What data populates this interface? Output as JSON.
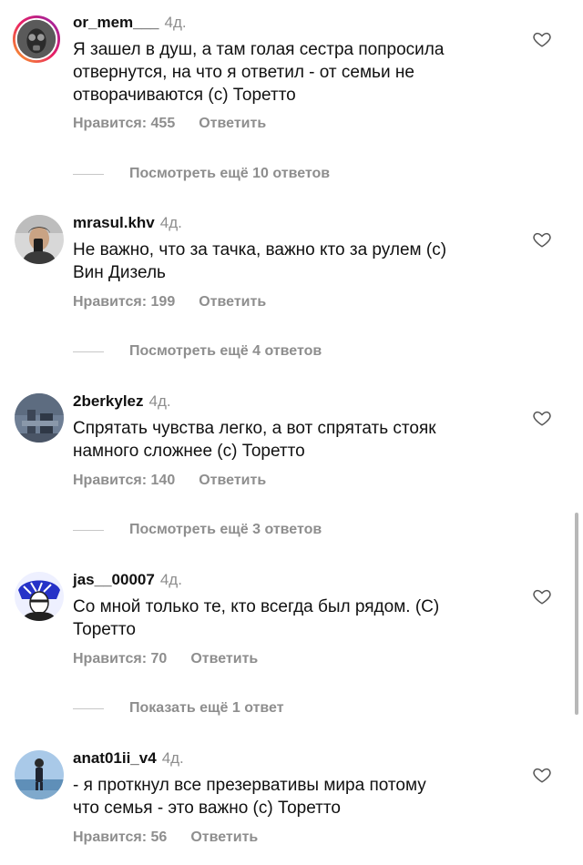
{
  "comments": [
    {
      "username": "or_mem___",
      "time": "4д.",
      "text": "Я зашел в душ, а там голая сестра попросила\nотвернутся, на что я ответил - от семьи не\nотворачиваются (с) Торетто",
      "likes": "Нравится: 455",
      "reply": "Ответить",
      "more": "Посмотреть ещё 10 ответов"
    },
    {
      "username": "mrasul.khv",
      "time": "4д.",
      "text": "Не важно, что за тачка, важно кто за рулем (с)\nВин Дизель",
      "likes": "Нравится: 199",
      "reply": "Ответить",
      "more": "Посмотреть ещё 4 ответов"
    },
    {
      "username": "2berkylez",
      "time": "4д.",
      "text": "Спрятать чувства легко, а вот спрятать стояк\nнамного сложнее (с) Торетто",
      "likes": "Нравится: 140",
      "reply": "Ответить",
      "more": "Посмотреть ещё 3 ответов"
    },
    {
      "username": "jas__00007",
      "time": "4д.",
      "text": "Со мной только те, кто всегда был рядом. (С)\nТоретто",
      "likes": "Нравится: 70",
      "reply": "Ответить",
      "more": "Показать ещё 1 ответ"
    },
    {
      "username": "anat01ii_v4",
      "time": "4д.",
      "text": "- я проткнул все презервативы мира потому\nчто семья - это важно (с) Торетто",
      "likes": "Нравится: 56",
      "reply": "Ответить"
    }
  ],
  "colors": {
    "text": "#111111",
    "muted": "#8e8e8e",
    "background": "#ffffff"
  },
  "icons": {
    "like": "heart-outline-icon"
  }
}
